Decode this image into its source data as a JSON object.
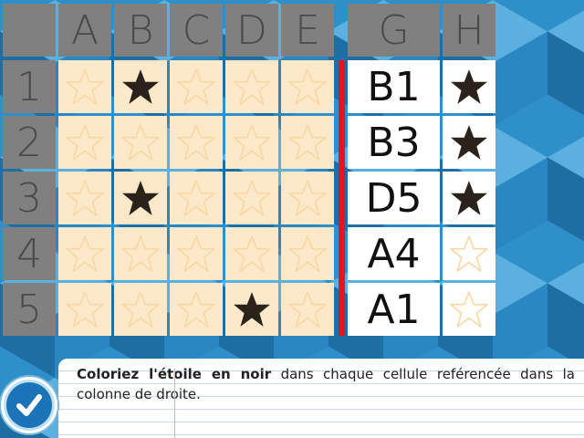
{
  "grid": {
    "columns": [
      "A",
      "B",
      "C",
      "D",
      "E"
    ],
    "rows": [
      "1",
      "2",
      "3",
      "4",
      "5"
    ],
    "filled": [
      [
        1,
        0
      ],
      [
        1,
        2
      ],
      [
        3,
        4
      ]
    ]
  },
  "reference": {
    "col_g_header": "G",
    "col_h_header": "H",
    "entries": [
      {
        "ref": "B1",
        "filled": true
      },
      {
        "ref": "B3",
        "filled": true
      },
      {
        "ref": "D5",
        "filled": true
      },
      {
        "ref": "A4",
        "filled": false
      },
      {
        "ref": "A1",
        "filled": false
      }
    ]
  },
  "instruction": {
    "bold": "Coloriez l'étoile en noir",
    "rest": " dans chaque cellule reférencée dans la colonne de droite."
  },
  "icons": {
    "star": "star-icon",
    "check": "check-icon"
  },
  "colors": {
    "header_gray": "#808080",
    "cell_cream": "#fde9c9",
    "star_outline": "#f8d9a6",
    "star_filled": "#2b221c",
    "divider_red": "#e8141b",
    "background_blue": "#2f8fc9"
  }
}
